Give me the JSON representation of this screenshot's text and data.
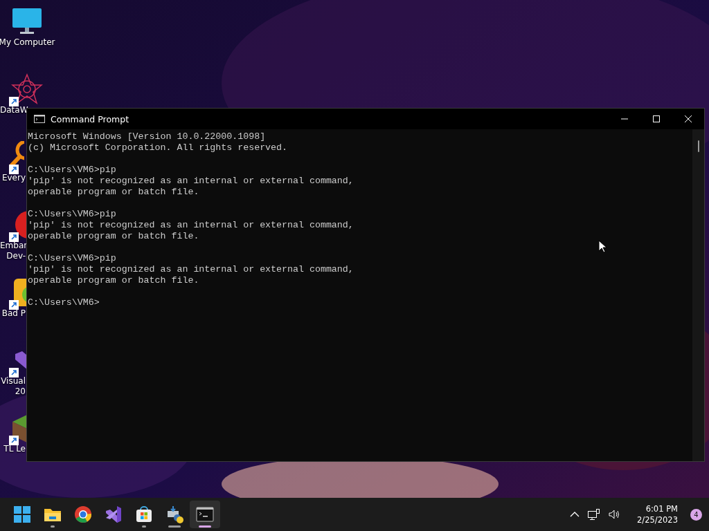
{
  "desktop_icons": [
    {
      "kind": "monitor",
      "label_lines": [
        "My Computer"
      ],
      "shortcut": false,
      "cut": false
    },
    {
      "kind": "star",
      "label_lines": [
        "DataW"
      ],
      "shortcut": true,
      "cut": true
    },
    {
      "kind": "magnifier",
      "label_lines": [
        "Every"
      ],
      "shortcut": true,
      "cut": true
    },
    {
      "kind": "redbox",
      "label_lines": [
        "Embar",
        "Dev-"
      ],
      "shortcut": true,
      "cut": true
    },
    {
      "kind": "game",
      "label_lines": [
        "Bad P"
      ],
      "shortcut": true,
      "cut": true
    },
    {
      "kind": "vs",
      "label_lines": [
        "Visual",
        "20"
      ],
      "shortcut": true,
      "cut": true
    },
    {
      "kind": "block",
      "label_lines": [
        "TL Le"
      ],
      "shortcut": true,
      "cut": true
    }
  ],
  "window": {
    "title": "Command Prompt",
    "focused": true,
    "console_blocks": [
      {
        "lines": [
          "Microsoft Windows [Version 10.0.22000.1098]",
          "(c) Microsoft Corporation. All rights reserved."
        ]
      },
      {
        "lines": [
          "C:\\Users\\VM6>pip",
          "'pip' is not recognized as an internal or external command,",
          "operable program or batch file."
        ]
      },
      {
        "lines": [
          "C:\\Users\\VM6>pip",
          "'pip' is not recognized as an internal or external command,",
          "operable program or batch file."
        ]
      },
      {
        "lines": [
          "C:\\Users\\VM6>pip",
          "'pip' is not recognized as an internal or external command,",
          "operable program or batch file."
        ]
      },
      {
        "lines": [
          "C:\\Users\\VM6>"
        ]
      }
    ]
  },
  "taskbar": {
    "apps": [
      {
        "kind": "start",
        "running": false,
        "active": false,
        "focused": false
      },
      {
        "kind": "folder",
        "running": true,
        "active": false,
        "focused": false
      },
      {
        "kind": "chrome",
        "running": false,
        "active": false,
        "focused": false
      },
      {
        "kind": "vs",
        "running": false,
        "active": false,
        "focused": false
      },
      {
        "kind": "store",
        "running": true,
        "active": false,
        "focused": false
      },
      {
        "kind": "installer",
        "running": true,
        "active": true,
        "focused": false
      },
      {
        "kind": "terminal",
        "running": true,
        "active": true,
        "focused": true
      }
    ],
    "time": "6:01 PM",
    "date": "2/25/2023",
    "notifications": "4"
  }
}
